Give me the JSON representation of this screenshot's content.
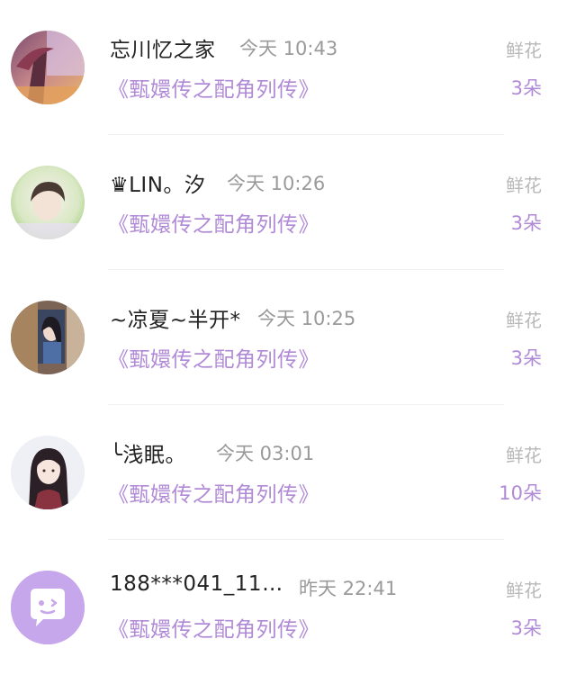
{
  "records": [
    {
      "name": "忘川忆之家",
      "time": "今天 10:43",
      "book": "《甄嬛传之配角列传》",
      "gift_label": "鲜花",
      "gift_count": "3朵"
    },
    {
      "name": "♛LIN。汐",
      "time": "今天 10:26",
      "book": "《甄嬛传之配角列传》",
      "gift_label": "鲜花",
      "gift_count": "3朵"
    },
    {
      "name": "~凉夏~半开*",
      "time": "今天 10:25",
      "book": "《甄嬛传之配角列传》",
      "gift_label": "鲜花",
      "gift_count": "3朵"
    },
    {
      "name": "╰浅眠。",
      "time": "今天 03:01",
      "book": "《甄嬛传之配角列传》",
      "gift_label": "鲜花",
      "gift_count": "10朵"
    },
    {
      "name": "188***041_11…",
      "time": "昨天 22:41",
      "book": "《甄嬛传之配角列传》",
      "gift_label": "鲜花",
      "gift_count": "3朵"
    }
  ],
  "colors": {
    "accent": "#b08ad6",
    "default_avatar_bg": "#c7a7ec"
  },
  "icons": {
    "default_avatar": "chat-bubble-face-icon"
  }
}
